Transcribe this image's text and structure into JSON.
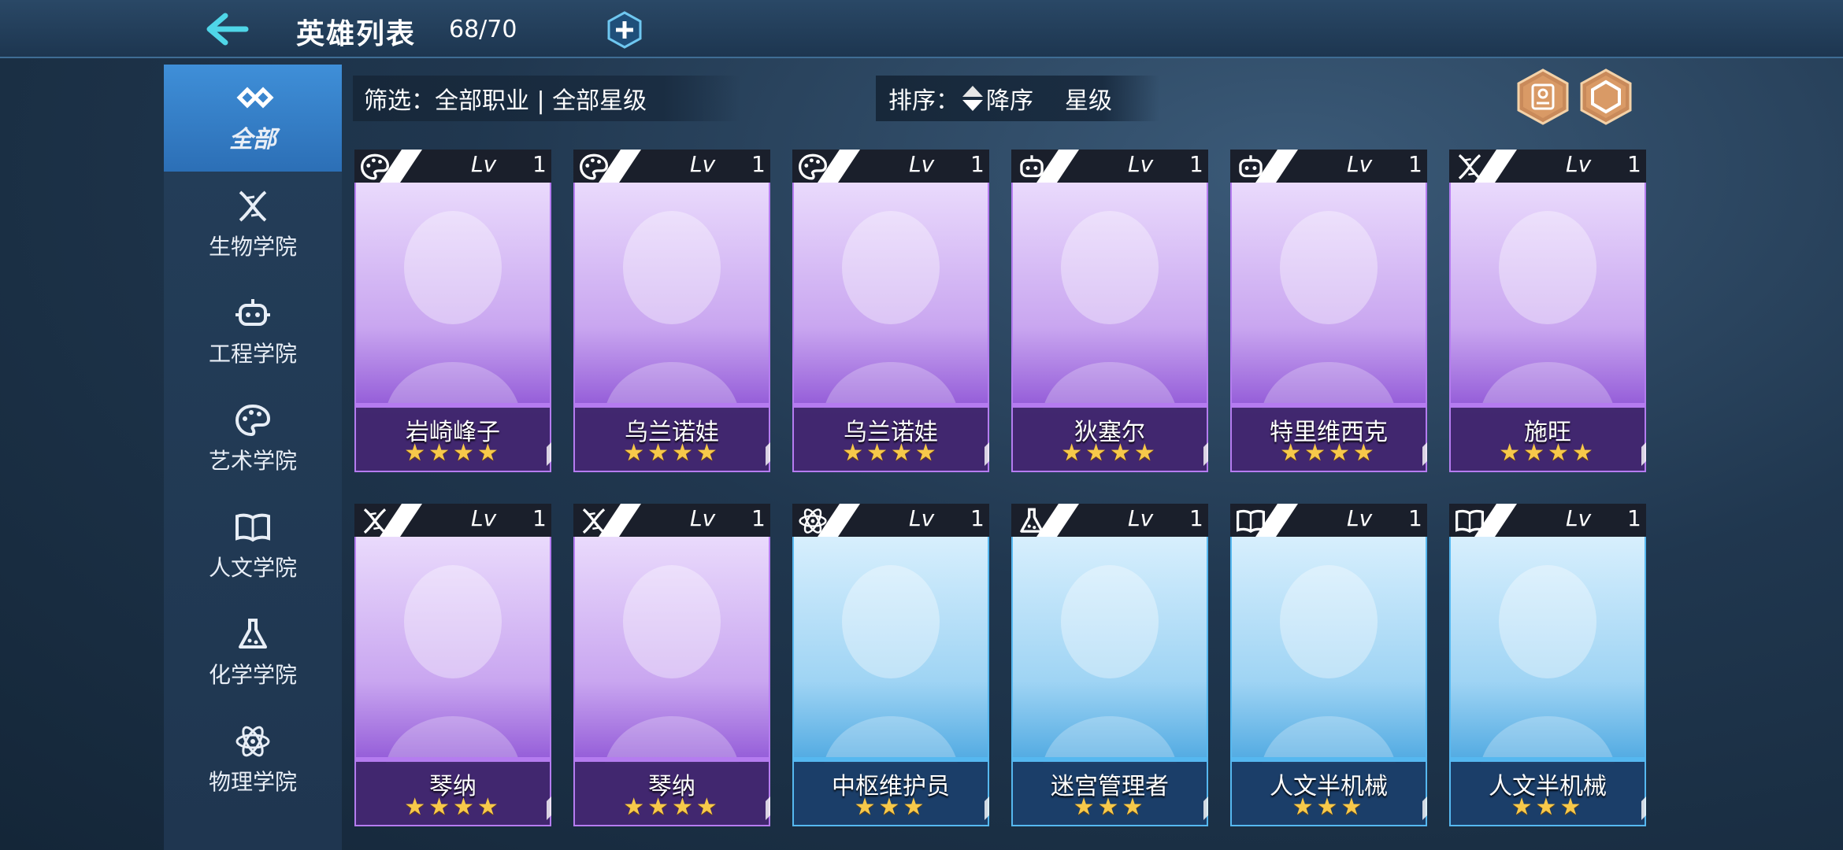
{
  "header": {
    "title": "英雄列表",
    "count": "68/70"
  },
  "sidebar": {
    "items": [
      {
        "label": "全部",
        "icon": "infinity-icon",
        "active": true
      },
      {
        "label": "生物学院",
        "icon": "dna-icon"
      },
      {
        "label": "工程学院",
        "icon": "robot-icon"
      },
      {
        "label": "艺术学院",
        "icon": "palette-icon"
      },
      {
        "label": "人文学院",
        "icon": "book-icon"
      },
      {
        "label": "化学学院",
        "icon": "flask-icon"
      },
      {
        "label": "物理学院",
        "icon": "atom-icon"
      }
    ]
  },
  "filter": {
    "label": "筛选：全部职业 | 全部星级"
  },
  "sort": {
    "label": "排序：",
    "direction": "降序",
    "key": "星级"
  },
  "level_prefix": "Lv",
  "colors": {
    "purple_card": "#a46be0",
    "blue_card": "#3aa0e0",
    "star": "#f7c94a",
    "sidebar_active": "#3f8fd8"
  },
  "heroes": [
    {
      "name": "岩崎峰子",
      "level": "1",
      "stars": "★★★★",
      "class_icon": "palette-icon",
      "frame": "purple"
    },
    {
      "name": "乌兰诺娃",
      "level": "1",
      "stars": "★★★★",
      "class_icon": "palette-icon",
      "frame": "purple"
    },
    {
      "name": "乌兰诺娃",
      "level": "1",
      "stars": "★★★★",
      "class_icon": "palette-icon",
      "frame": "purple"
    },
    {
      "name": "狄塞尔",
      "level": "1",
      "stars": "★★★★",
      "class_icon": "robot-icon",
      "frame": "purple"
    },
    {
      "name": "特里维西克",
      "level": "1",
      "stars": "★★★★",
      "class_icon": "robot-icon",
      "frame": "purple"
    },
    {
      "name": "施旺",
      "level": "1",
      "stars": "★★★★",
      "class_icon": "dna-icon",
      "frame": "purple"
    },
    {
      "name": "琴纳",
      "level": "1",
      "stars": "★★★★",
      "class_icon": "dna-icon",
      "frame": "purple"
    },
    {
      "name": "琴纳",
      "level": "1",
      "stars": "★★★★",
      "class_icon": "dna-icon",
      "frame": "purple"
    },
    {
      "name": "中枢维护员",
      "level": "1",
      "stars": "★★★",
      "class_icon": "atom-icon",
      "frame": "blue"
    },
    {
      "name": "迷宫管理者",
      "level": "1",
      "stars": "★★★",
      "class_icon": "flask-icon",
      "frame": "blue"
    },
    {
      "name": "人文半机械",
      "level": "1",
      "stars": "★★★",
      "class_icon": "book-icon",
      "frame": "blue"
    },
    {
      "name": "人文半机械",
      "level": "1",
      "stars": "★★★",
      "class_icon": "book-icon",
      "frame": "blue"
    }
  ]
}
